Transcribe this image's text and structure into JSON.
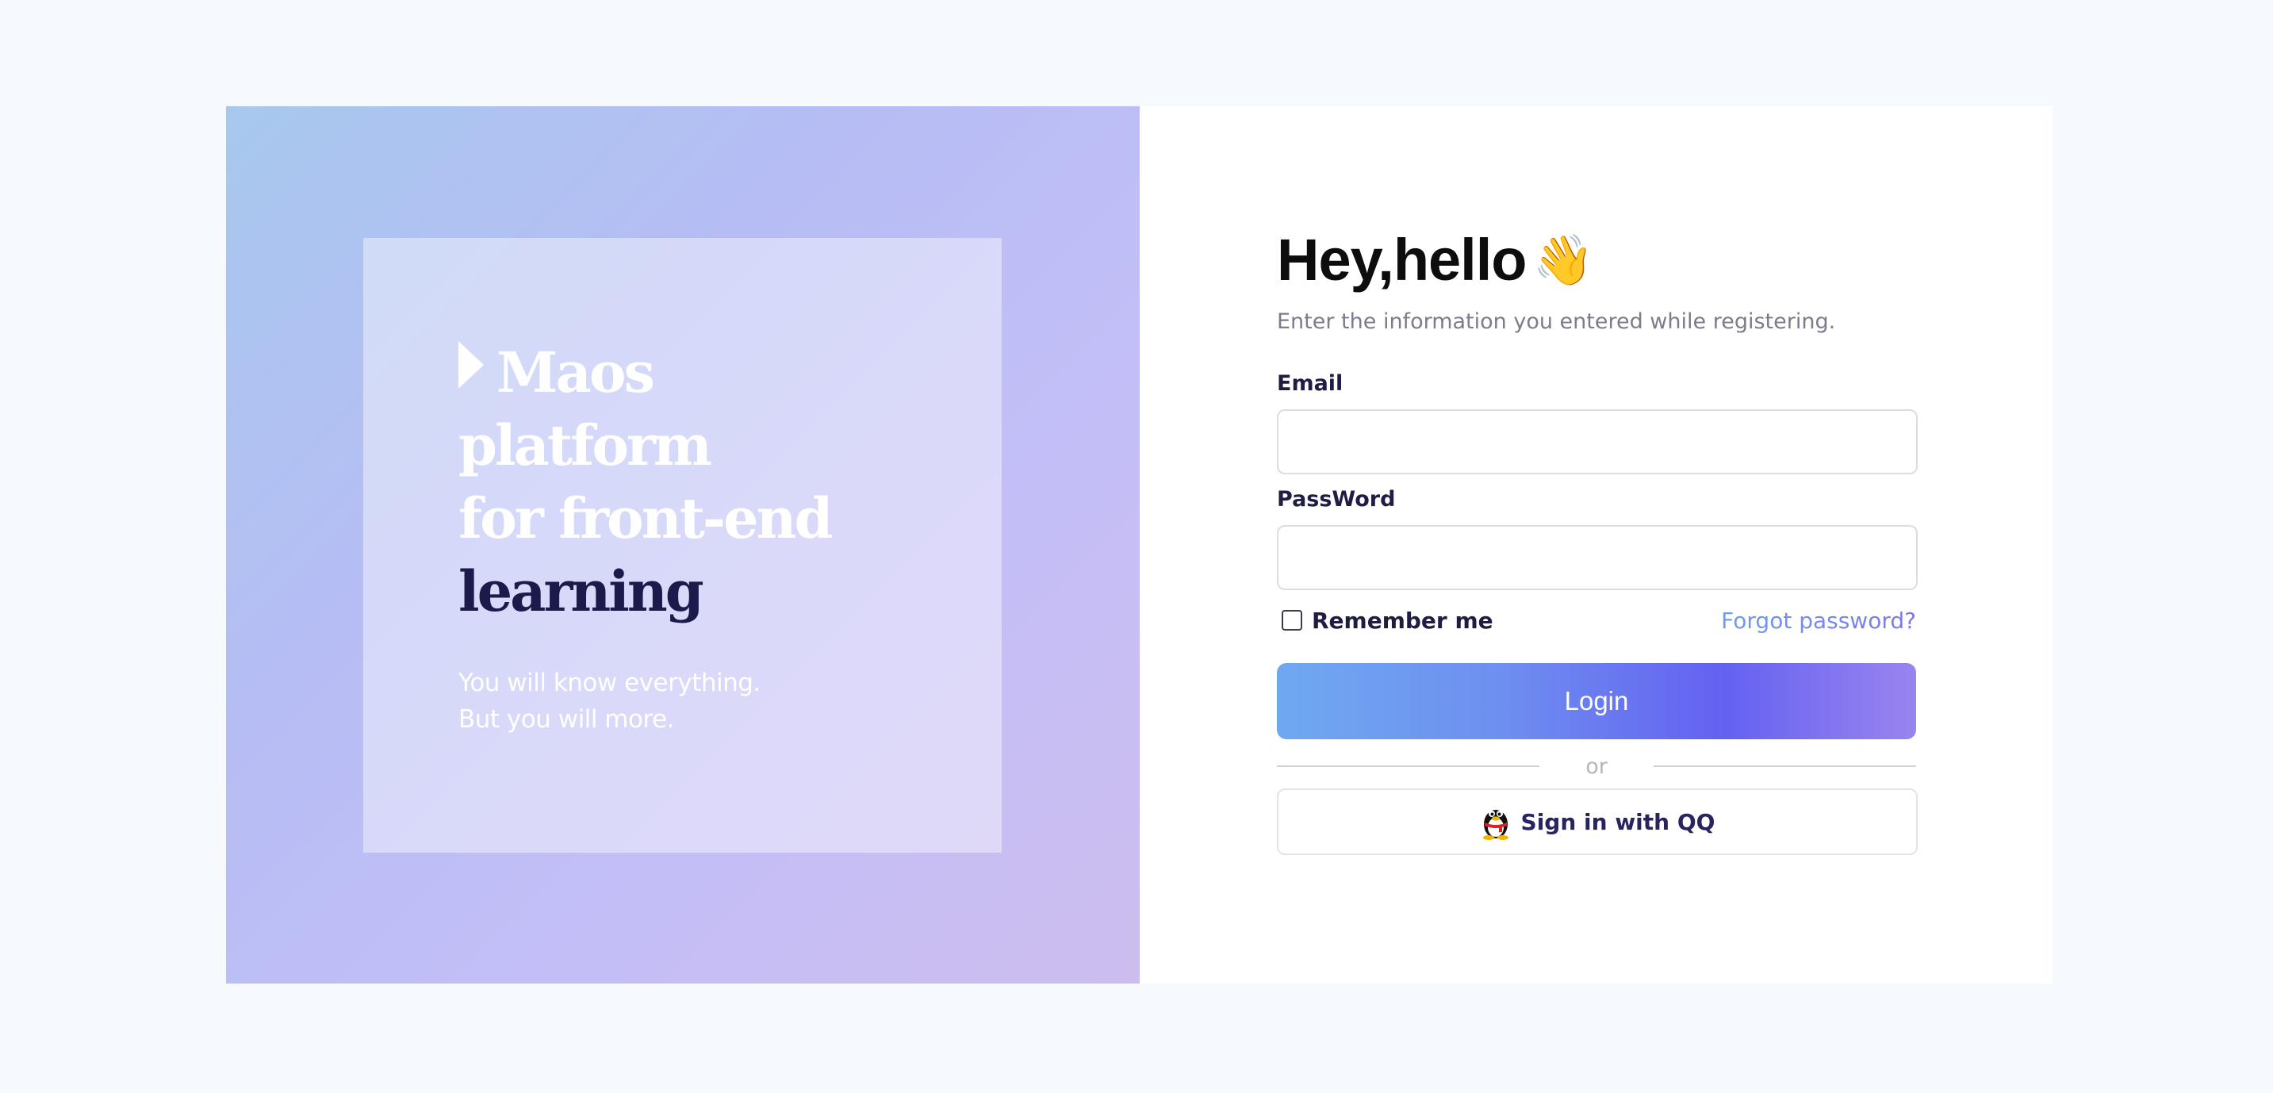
{
  "brand": {
    "line1": "Maos",
    "line2": "platform",
    "line3": "for front-end",
    "line4": "learning",
    "tagline_1": "You will know everything.",
    "tagline_2": "But you will more."
  },
  "login": {
    "title": "Hey,hello",
    "wave_emoji": "👋",
    "subtitle": "Enter the information you entered while registering.",
    "email_label": "Email",
    "email_value": "",
    "password_label": "PassWord",
    "password_value": "",
    "remember_label": "Remember me",
    "remember_checked": false,
    "forgot_label": "Forgot password?",
    "login_label": "Login",
    "divider_label": "or",
    "qq_label": "Sign in with QQ"
  },
  "colors": {
    "accent_blue": "#6fa9f1",
    "accent_purple": "#6461f1",
    "brand_dark": "#1c1a4a",
    "background": "#f6f9fe"
  },
  "icons": {
    "brand": "play-triangle-icon",
    "qq": "qq-penguin-icon"
  }
}
